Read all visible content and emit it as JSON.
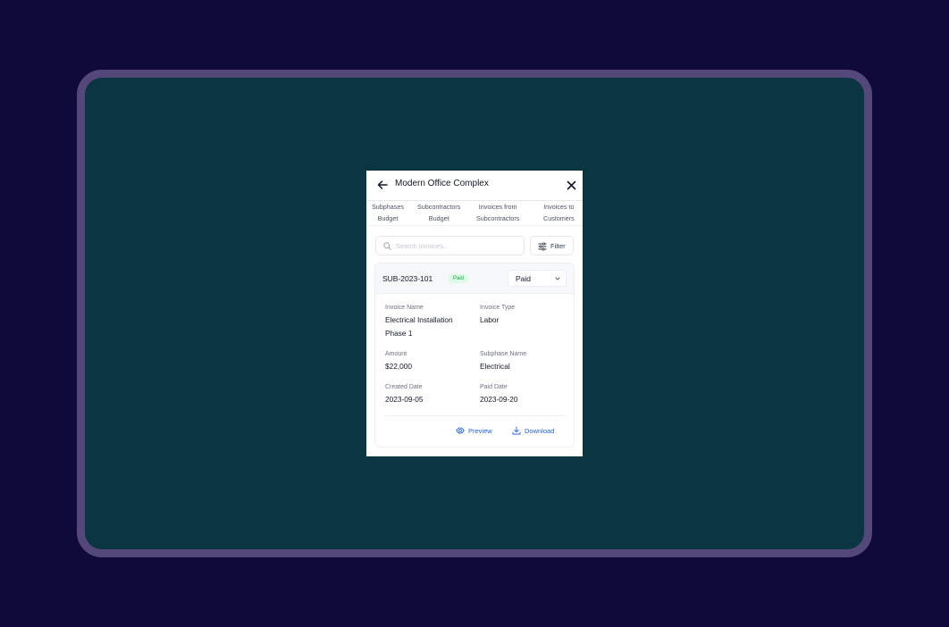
{
  "header": {
    "title": "Modern Office Complex"
  },
  "tabs": [
    {
      "line1": "Subphases",
      "line2": "Budget"
    },
    {
      "line1": "Subcontractors",
      "line2": "Budget"
    },
    {
      "line1": "Invoices from",
      "line2": "Subcontractors"
    },
    {
      "line1": "Invoices to",
      "line2": "Customers"
    }
  ],
  "search": {
    "placeholder": "Search invoices..."
  },
  "filter": {
    "label": "Filter"
  },
  "invoice": {
    "id": "SUB-2023-101",
    "badge": "Paid",
    "status": "Paid",
    "fields": {
      "invoice_name_label": "Invoice Name",
      "invoice_name_line1": "Electrical Installation",
      "invoice_name_line2": "Phase 1",
      "invoice_type_label": "Invoice Type",
      "invoice_type": "Labor",
      "amount_label": "Amount",
      "amount": "$22,000",
      "subphase_label": "Subphase Name",
      "subphase": "Electrical",
      "created_label": "Created Date",
      "created": "2023-09-05",
      "paid_label": "Paid Date",
      "paid": "2023-09-20"
    },
    "actions": {
      "preview": "Preview",
      "download": "Download"
    }
  },
  "colors": {
    "background": "#100a38",
    "frame": "#534879",
    "screen": "#0b3540",
    "accent": "#2563eb",
    "badge_bg": "#dcfce7",
    "badge_text": "#16a34a"
  },
  "icons": [
    "back-arrow-icon",
    "close-icon",
    "search-icon",
    "filter-sliders-icon",
    "chevron-down-icon",
    "eye-icon",
    "download-icon"
  ]
}
